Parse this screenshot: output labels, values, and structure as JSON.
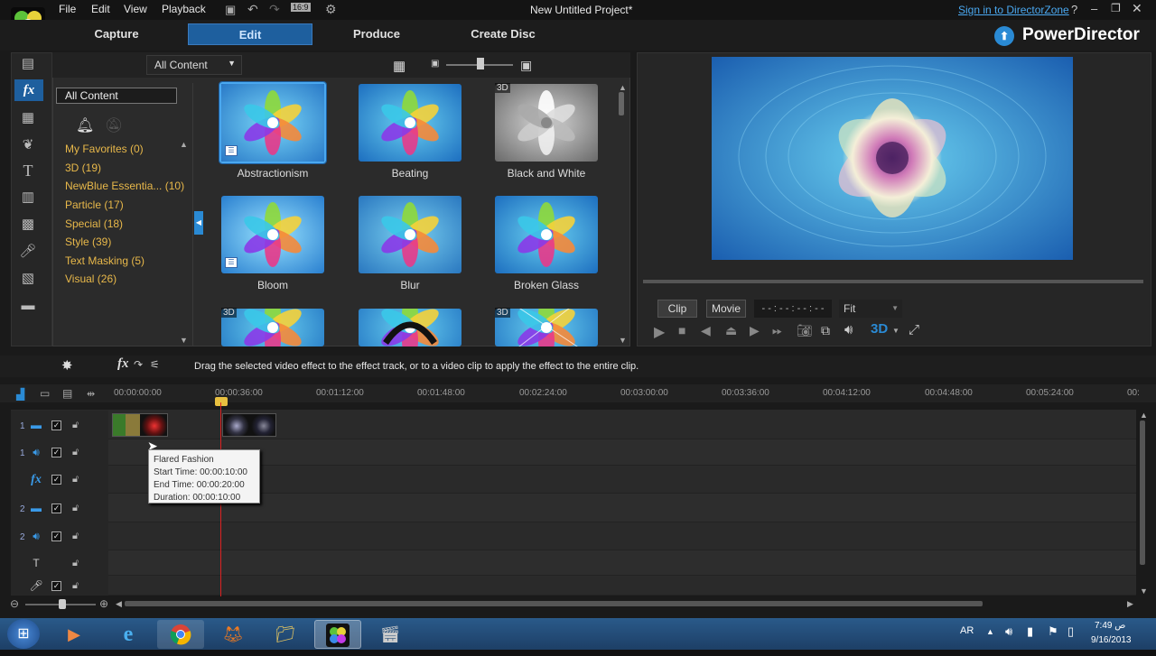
{
  "titlebar": {
    "menus": [
      "File",
      "Edit",
      "View",
      "Playback"
    ],
    "project_title": "New Untitled Project*",
    "sign_in": "Sign in to DirectorZone",
    "zoom_label": "16:9"
  },
  "modes": {
    "capture": "Capture",
    "edit": "Edit",
    "produce": "Produce",
    "create_disc": "Create Disc"
  },
  "brand": {
    "name": "PowerDirector"
  },
  "library": {
    "filter_select": "All Content",
    "category_select": "All Content",
    "categories": [
      {
        "label": "My Favorites  (0)"
      },
      {
        "label": "3D  (19)"
      },
      {
        "label": "NewBlue Essentia...  (10)"
      },
      {
        "label": "Particle  (17)"
      },
      {
        "label": "Special  (18)"
      },
      {
        "label": "Style  (39)"
      },
      {
        "label": "Text Masking  (5)"
      },
      {
        "label": "Visual  (26)"
      }
    ],
    "effects": [
      {
        "name": "Abstractionism",
        "badge": "",
        "style": "abstract"
      },
      {
        "name": "Beating",
        "badge": "",
        "style": "normal"
      },
      {
        "name": "Black and White",
        "badge": "3D",
        "style": "bw"
      },
      {
        "name": "Bloom",
        "badge": "",
        "style": "bloom"
      },
      {
        "name": "Blur",
        "badge": "",
        "style": "blur"
      },
      {
        "name": "Broken Glass",
        "badge": "",
        "style": "normal"
      },
      {
        "name": "",
        "badge": "3D",
        "style": "normal"
      },
      {
        "name": "",
        "badge": "",
        "style": "dark"
      },
      {
        "name": "",
        "badge": "3D",
        "style": "glass"
      }
    ]
  },
  "preview": {
    "clip_tab": "Clip",
    "movie_tab": "Movie",
    "timecode": "- - : - - : - - : - -",
    "fit": "Fit",
    "label_3d": "3D"
  },
  "infobar": {
    "hint": "Drag the selected video effect to the effect track, or to a video clip to apply the effect to the entire clip."
  },
  "ruler": {
    "ticks": [
      "00:00:00:00",
      "00:00:36:00",
      "00:01:12:00",
      "00:01:48:00",
      "00:02:24:00",
      "00:03:00:00",
      "00:03:36:00",
      "00:04:12:00",
      "00:04:48:00",
      "00:05:24:00",
      "00:"
    ]
  },
  "tracks": [
    {
      "num": "1",
      "icon": "video-icon"
    },
    {
      "num": "1",
      "icon": "audio-icon"
    },
    {
      "num": "",
      "icon": "fx-icon"
    },
    {
      "num": "2",
      "icon": "video-icon"
    },
    {
      "num": "2",
      "icon": "audio-icon"
    },
    {
      "num": "",
      "icon": "title-icon"
    },
    {
      "num": "",
      "icon": "voice-icon"
    }
  ],
  "tooltip": {
    "title": "Flared Fashion",
    "start": "Start Time: 00:00:10:00",
    "end": "End Time: 00:00:20:00",
    "duration": "Duration: 00:00:10:00"
  },
  "tray": {
    "lang": "AR",
    "time": "7:49 ص",
    "date": "9/16/2013"
  },
  "colors": {
    "accent": "#2a8ad4",
    "category": "#e8b84a",
    "tab_active": "#1e5f9e"
  }
}
